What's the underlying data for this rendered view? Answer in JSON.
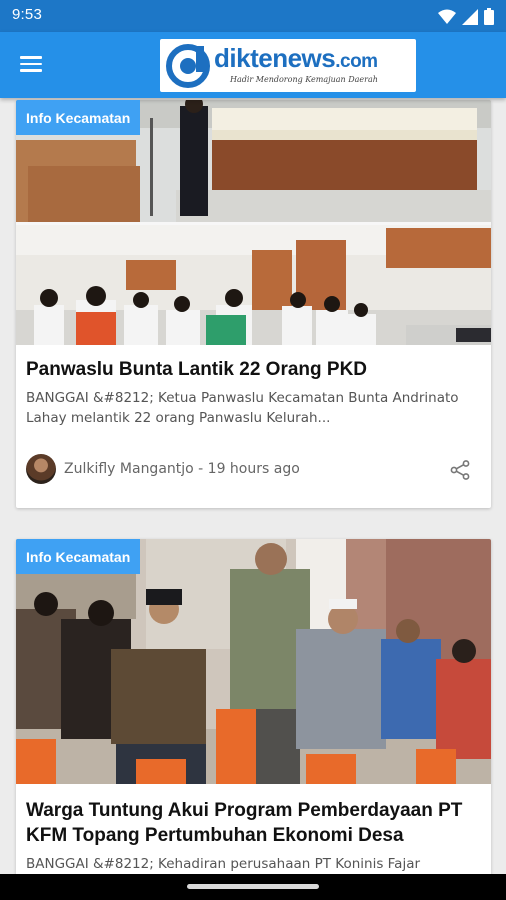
{
  "status": {
    "time": "9:53",
    "icons": [
      "wifi-icon",
      "signal-icon",
      "battery-icon"
    ]
  },
  "appbar": {
    "menu_icon": "menu-icon",
    "logo": {
      "part1": "dikte",
      "part2": "news",
      "part3": ".com",
      "tagline": "Hadir Mendorong Kemajuan Daerah"
    }
  },
  "articles": [
    {
      "category": "Info Kecamatan",
      "title": "Panwaslu Bunta Lantik 22 Orang PKD",
      "excerpt": "BANGGAI &#8212; Ketua Panwaslu Kecamatan Bunta Andrinato Lahay melantik 22 orang Panwaslu Kelurah...",
      "author": "Zulkifly Mangantjo",
      "time": "19 hours ago",
      "byline": "Zulkifly Mangantjo - 19 hours ago",
      "share_icon": "share-icon"
    },
    {
      "category": "Info Kecamatan",
      "title": "Warga Tuntung Akui Program Pemberdayaan PT KFM Topang Pertumbuhan Ekonomi Desa",
      "excerpt": "BANGGAI &#8212; Kehadiran perusahaan PT Koninis Fajar"
    }
  ],
  "colors": {
    "status_bar": "#1d77c7",
    "app_bar": "#2590e8",
    "tag": "#3fa1f3",
    "background": "#ececec"
  }
}
